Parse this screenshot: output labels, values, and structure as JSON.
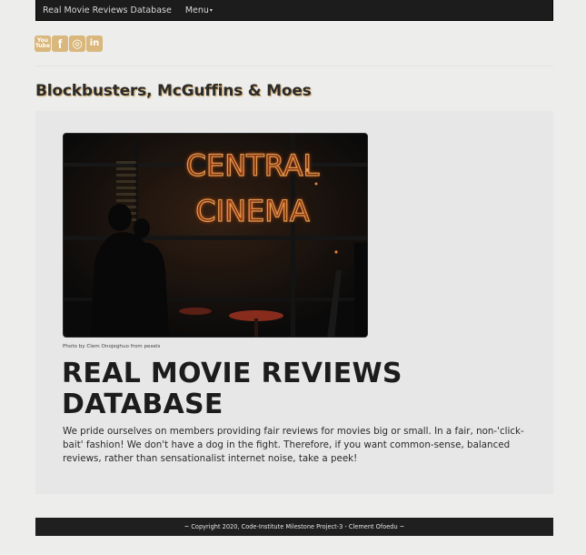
{
  "navbar": {
    "brand": "Real Movie Reviews Database",
    "menu_label": "Menu",
    "caret": "▾"
  },
  "social": {
    "items": [
      {
        "name": "youtube-icon",
        "glyph": "You\nTube"
      },
      {
        "name": "facebook-icon",
        "glyph": "f"
      },
      {
        "name": "instagram-icon",
        "glyph": "◎"
      },
      {
        "name": "linkedin-icon",
        "glyph": "in"
      }
    ],
    "accent": "#d9b77d"
  },
  "page": {
    "title": "Blockbusters, McGuffins & Moes"
  },
  "hero": {
    "sign_line1": "CENTRAL",
    "sign_line2": "CINEMA",
    "caption": "Photo by Clem Onojeghuo from pexels",
    "headline": "REAL MOVIE REVIEWS DATABASE",
    "description": "We pride ourselves on members providing fair reviews for movies big or small. In a fair, non-'click-bait' fashion! We don't have a dog in the fight. Therefore, if you want common-sense, balanced reviews, rather than sensationalist internet noise, take a peek!"
  },
  "footer": {
    "text": "~ Copyright 2020, Code-Institute Milestone Project-3 - Clement Ofoedu ~"
  },
  "colors": {
    "navbar_bg": "#1c1c1c",
    "neon": "#ff6a1f",
    "title_shadow": "#c9a15a"
  }
}
